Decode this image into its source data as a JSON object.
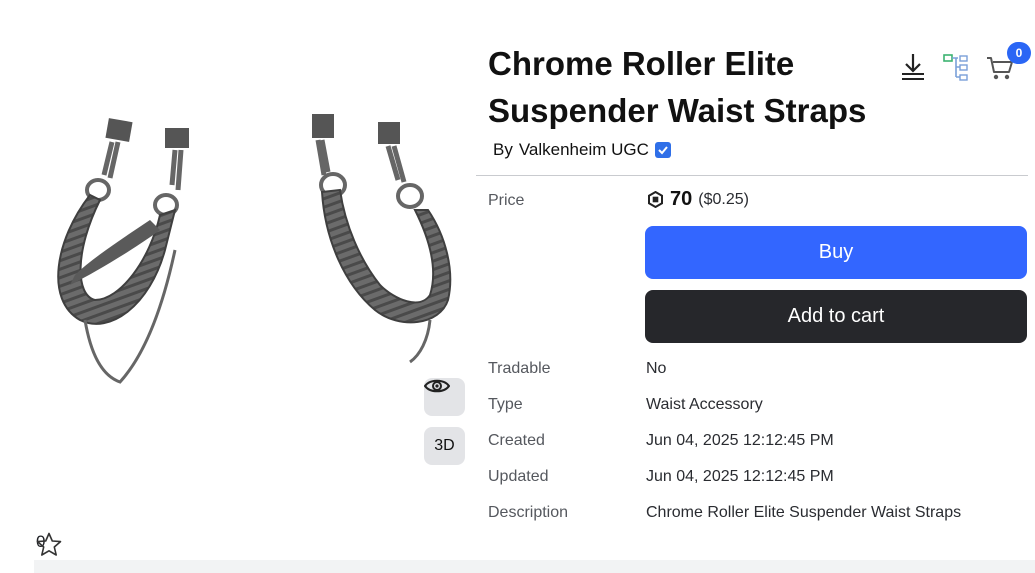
{
  "item": {
    "title": "Chrome Roller Elite Suspender Waist Straps",
    "by_prefix": "By",
    "creator": "Valkenheim UGC"
  },
  "header_icons": [
    "download-icon",
    "hierarchy-icon",
    "cart-icon"
  ],
  "cart_count": "0",
  "price": {
    "label": "Price",
    "amount": "70",
    "usd": "($0.25)"
  },
  "buttons": {
    "buy": "Buy",
    "add_to_cart": "Add to cart"
  },
  "details": [
    {
      "label": "Tradable",
      "value": "No"
    },
    {
      "label": "Type",
      "value": "Waist Accessory"
    },
    {
      "label": "Created",
      "value": "Jun 04, 2025 12:12:45 PM"
    },
    {
      "label": "Updated",
      "value": "Jun 04, 2025 12:12:45 PM"
    },
    {
      "label": "Description",
      "value": "Chrome Roller Elite Suspender Waist Straps"
    }
  ],
  "preview": {
    "view_3d_label": "3D",
    "favorites_count": "0"
  },
  "colors": {
    "buy": "#3366ff",
    "cart_button": "#26272b",
    "badge": "#2a66f5",
    "verified": "#2f6fe8"
  }
}
